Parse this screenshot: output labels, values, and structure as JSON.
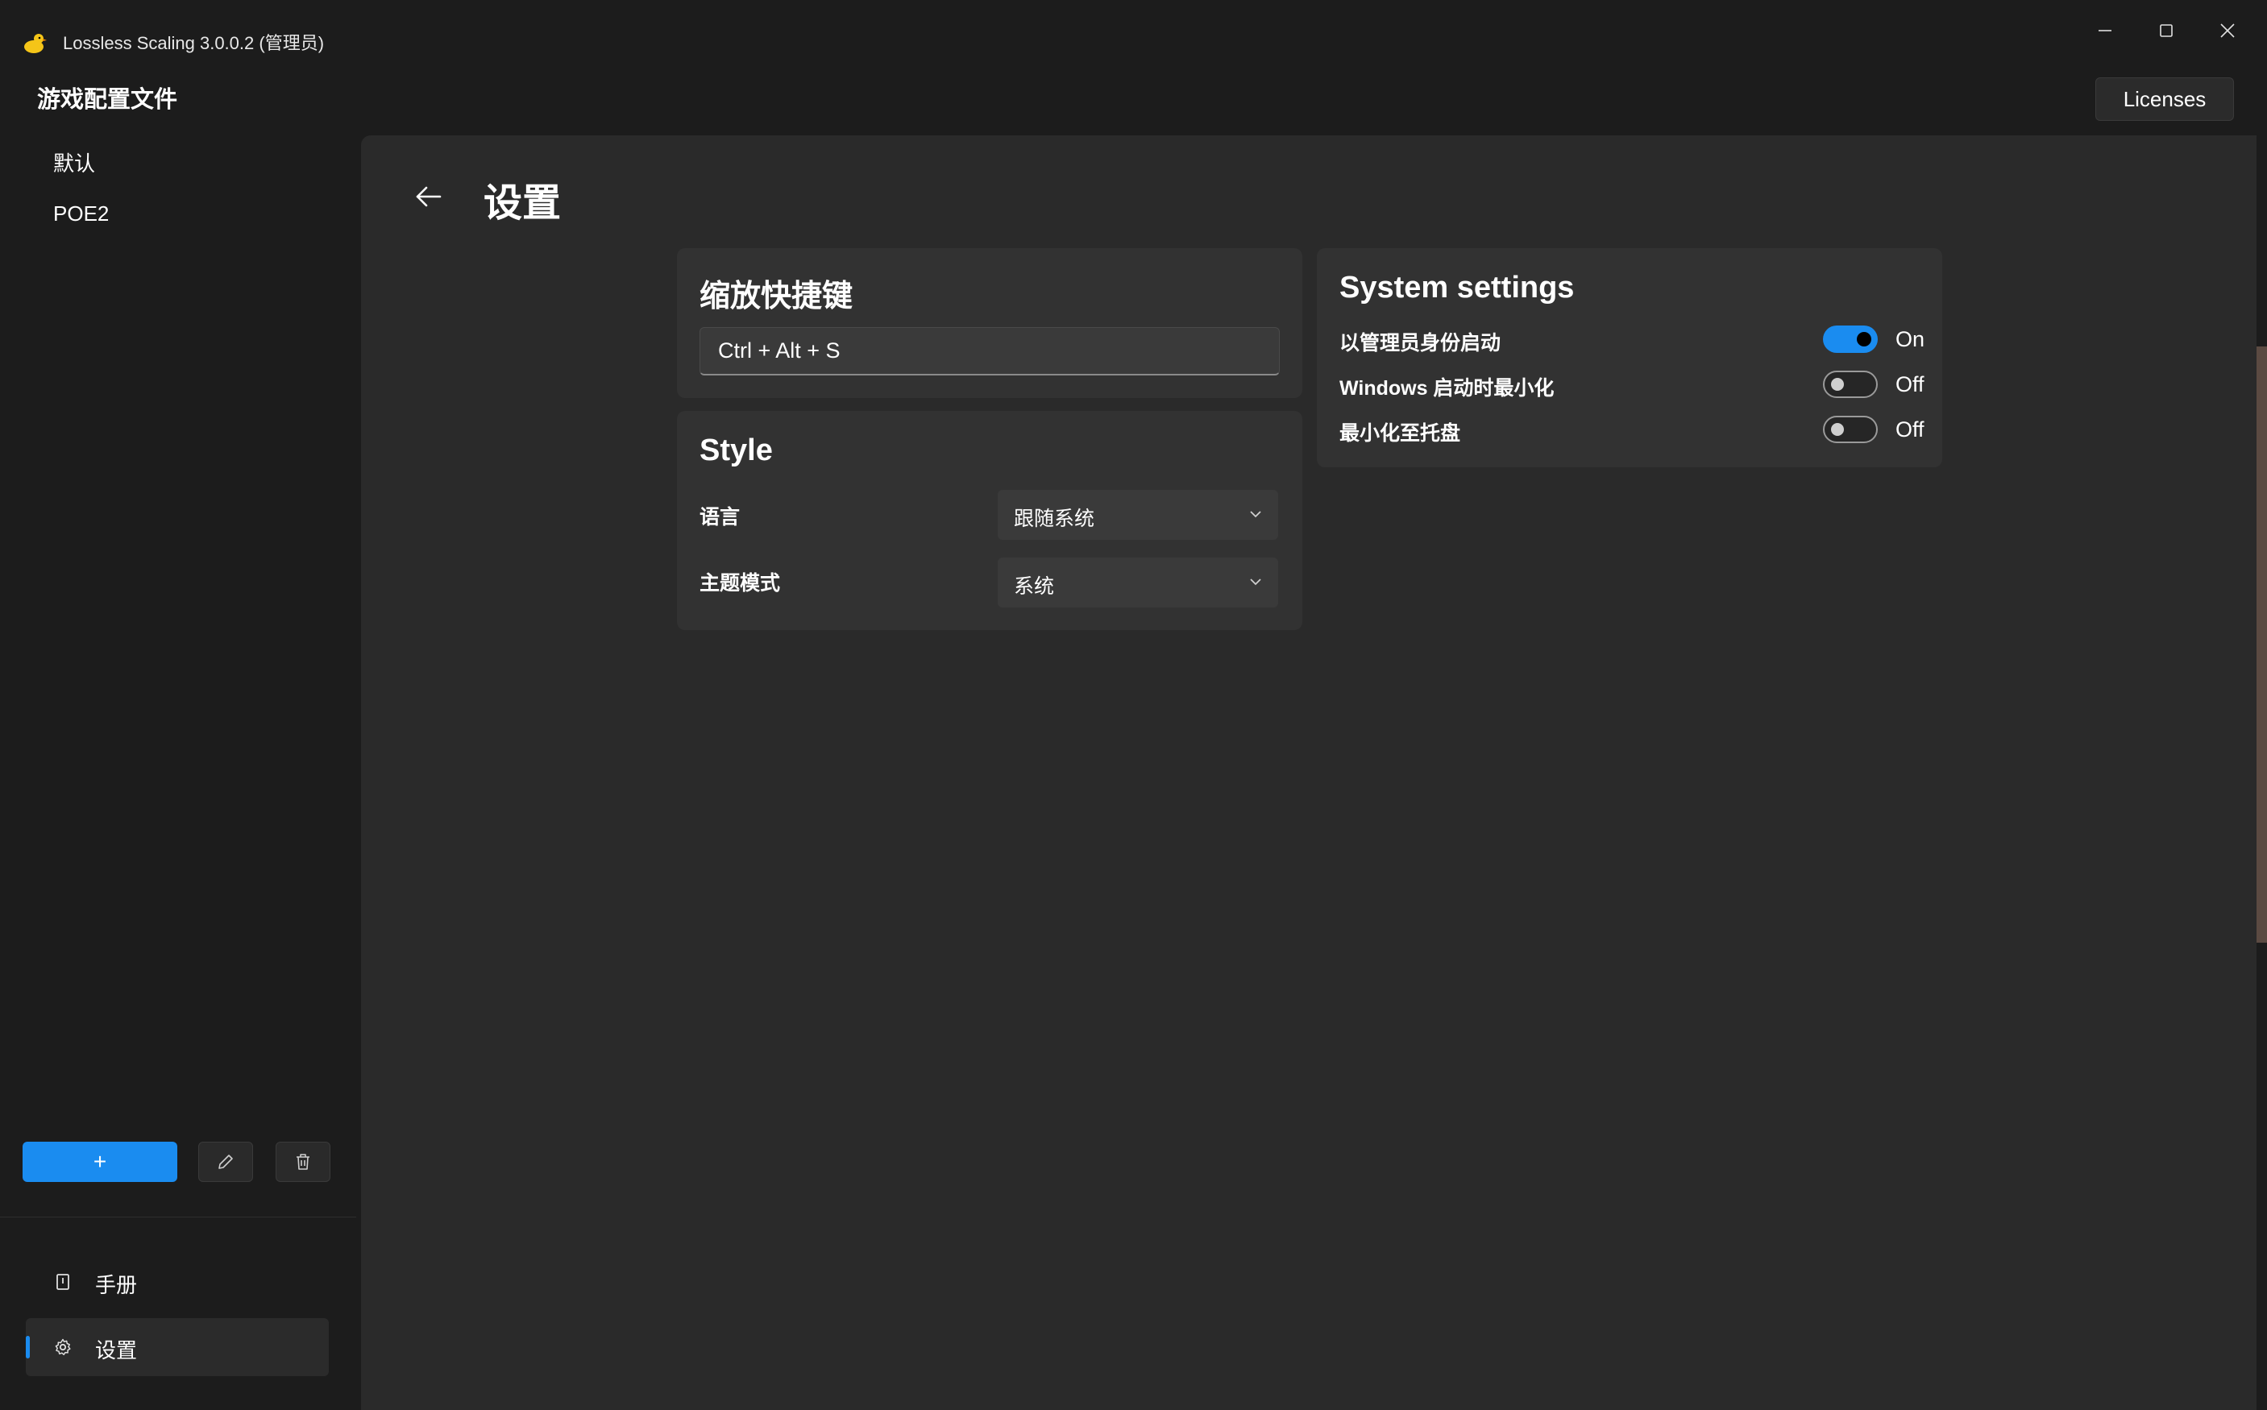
{
  "window": {
    "title": "Lossless Scaling 3.0.0.2 (管理员)",
    "icons": {
      "app": "duck-icon",
      "minimize": "minimize-icon",
      "maximize": "maximize-icon",
      "close": "close-icon"
    }
  },
  "header": {
    "sidebar_title": "游戏配置文件",
    "licenses_label": "Licenses"
  },
  "sidebar": {
    "profiles": [
      {
        "label": "默认"
      },
      {
        "label": "POE2"
      }
    ],
    "add_label": "+",
    "edit_icon": "pencil-icon",
    "delete_icon": "trash-icon",
    "nav": [
      {
        "label": "手册",
        "icon": "book-icon",
        "active": false
      },
      {
        "label": "设置",
        "icon": "gear-icon",
        "active": true
      }
    ]
  },
  "page": {
    "title": "设置",
    "back_icon": "back-arrow-icon"
  },
  "hotkey_card": {
    "title": "缩放快捷键",
    "value": "Ctrl + Alt + S"
  },
  "style_card": {
    "title": "Style",
    "rows": [
      {
        "label": "语言",
        "value": "跟随系统"
      },
      {
        "label": "主题模式",
        "value": "系统"
      }
    ]
  },
  "system_card": {
    "title": "System settings",
    "rows": [
      {
        "label": "以管理员身份启动",
        "state": "On",
        "enabled": true
      },
      {
        "label": "Windows 启动时最小化",
        "state": "Off",
        "enabled": false
      },
      {
        "label": "最小化至托盘",
        "state": "Off",
        "enabled": false
      }
    ]
  },
  "colors": {
    "accent": "#1a8cf0",
    "window_bg": "#1c1c1c",
    "content_bg": "#2a2a2a",
    "card_bg": "#323232"
  }
}
